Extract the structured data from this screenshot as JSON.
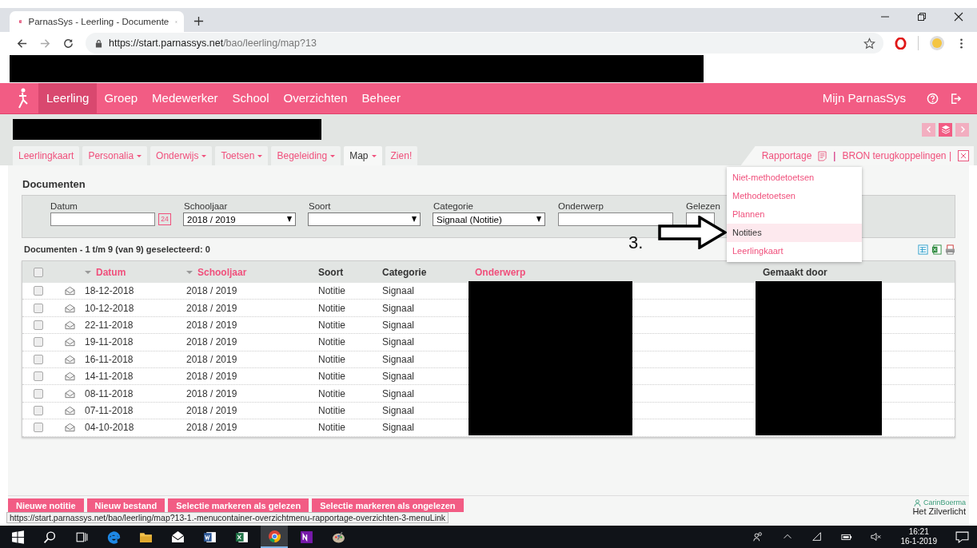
{
  "browser": {
    "tab_title": "ParnasSys - Leerling - Documente",
    "url_host": "https://start.parnassys.net",
    "url_path": "/bao/leerling/map?13"
  },
  "nav": {
    "items": [
      {
        "label": "Leerling",
        "selected": true
      },
      {
        "label": "Groep",
        "selected": false
      },
      {
        "label": "Medewerker",
        "selected": false
      },
      {
        "label": "School",
        "selected": false
      },
      {
        "label": "Overzichten",
        "selected": false
      },
      {
        "label": "Beheer",
        "selected": false
      }
    ],
    "account": "Mijn ParnasSys"
  },
  "subtabs": [
    {
      "label": "Leerlingkaart",
      "dropdown": false,
      "selected": false
    },
    {
      "label": "Personalia",
      "dropdown": true,
      "selected": false
    },
    {
      "label": "Onderwijs",
      "dropdown": true,
      "selected": false
    },
    {
      "label": "Toetsen",
      "dropdown": true,
      "selected": false
    },
    {
      "label": "Begeleiding",
      "dropdown": true,
      "selected": false
    },
    {
      "label": "Map",
      "dropdown": true,
      "selected": true
    },
    {
      "label": "Zien!",
      "dropdown": false,
      "selected": false
    }
  ],
  "report_bar": {
    "rapportage": "Rapportage",
    "separator": "|",
    "bron": "BRON terugkoppelingen |"
  },
  "report_menu": [
    {
      "label": "Niet-methodetoetsen",
      "selected": false
    },
    {
      "label": "Methodetoetsen",
      "selected": false
    },
    {
      "label": "Plannen",
      "selected": false
    },
    {
      "label": "Notities",
      "selected": true
    },
    {
      "label": "Leerlingkaart",
      "selected": false
    }
  ],
  "page_title": "Documenten",
  "filters": [
    {
      "label": "Datum",
      "kind": "date",
      "calendar_day": "24"
    },
    {
      "label": "Schooljaar",
      "kind": "select",
      "value": "2018 / 2019"
    },
    {
      "label": "Soort",
      "kind": "select"
    },
    {
      "label": "Categorie",
      "kind": "select",
      "value": "Signaal (Notitie)"
    },
    {
      "label": "Onderwerp",
      "kind": "text"
    },
    {
      "label": "Gelezen",
      "kind": "short"
    }
  ],
  "count": "Documenten - 1 t/m 9 (van 9) geselecteerd: 0",
  "annotation": "3.",
  "table": {
    "select_all_checked": false,
    "columns": [
      {
        "label": "Datum",
        "link": true,
        "sort_caret": true
      },
      {
        "label": "Schooljaar",
        "link": true,
        "sort_caret": true
      },
      {
        "label": "Soort",
        "link": false,
        "sort_caret": false
      },
      {
        "label": "Categorie",
        "link": false,
        "sort_caret": false
      },
      {
        "label": "Onderwerp",
        "link": true,
        "sort_caret": false
      },
      {
        "label": "Gemaakt door",
        "link": false,
        "sort_caret": false
      }
    ],
    "rows": [
      {
        "checked": false,
        "datum": "18-12-2018",
        "schooljaar": "2018 / 2019",
        "soort": "Notitie",
        "categorie": "Signaal"
      },
      {
        "checked": false,
        "datum": "10-12-2018",
        "schooljaar": "2018 / 2019",
        "soort": "Notitie",
        "categorie": "Signaal"
      },
      {
        "checked": false,
        "datum": "22-11-2018",
        "schooljaar": "2018 / 2019",
        "soort": "Notitie",
        "categorie": "Signaal"
      },
      {
        "checked": false,
        "datum": "19-11-2018",
        "schooljaar": "2018 / 2019",
        "soort": "Notitie",
        "categorie": "Signaal"
      },
      {
        "checked": false,
        "datum": "16-11-2018",
        "schooljaar": "2018 / 2019",
        "soort": "Notitie",
        "categorie": "Signaal"
      },
      {
        "checked": false,
        "datum": "14-11-2018",
        "schooljaar": "2018 / 2019",
        "soort": "Notitie",
        "categorie": "Signaal"
      },
      {
        "checked": false,
        "datum": "08-11-2018",
        "schooljaar": "2018 / 2019",
        "soort": "Notitie",
        "categorie": "Signaal"
      },
      {
        "checked": false,
        "datum": "07-11-2018",
        "schooljaar": "2018 / 2019",
        "soort": "Notitie",
        "categorie": "Signaal"
      },
      {
        "checked": false,
        "datum": "04-10-2018",
        "schooljaar": "2018 / 2019",
        "soort": "Notitie",
        "categorie": "Signaal"
      }
    ]
  },
  "footer": {
    "buttons": [
      "Nieuwe notitie",
      "Nieuw bestand",
      "Selectie markeren als gelezen",
      "Selectie markeren als ongelezen"
    ],
    "user": "CarinBoerma",
    "school": "Het Zilverlicht"
  },
  "status_url": "https://start.parnassys.net/bao/leerling/map?13-1.-menucontainer-overzichtmenu-rapportage-overzichten-3-menuLink",
  "taskbar": {
    "time": "16:21",
    "date": "16-1-2019"
  }
}
